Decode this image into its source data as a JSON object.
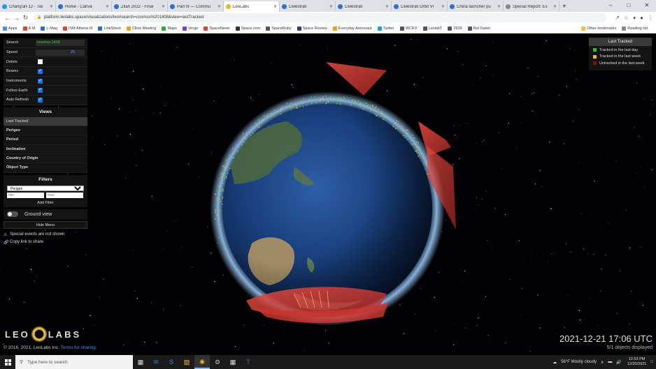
{
  "browser": {
    "tabs": [
      {
        "label": "Chang'an-12 - Twi",
        "color": "#1d9bf0"
      },
      {
        "label": "Home - Canva",
        "color": "#2b6ed6"
      },
      {
        "label": "Zilan 2022 - Final",
        "color": "#2b6ed6"
      },
      {
        "label": "Part III — Commu",
        "color": "#2b6ed6"
      },
      {
        "label": "LeoLabs",
        "color": "#e8b422",
        "active": true
      },
      {
        "label": "Celestrak",
        "color": "#2b6ed6"
      },
      {
        "label": "Celestrak",
        "color": "#2b6ed6"
      },
      {
        "label": "Celestrak Orbit Vi",
        "color": "#2b6ed6"
      },
      {
        "label": "China launcher pu",
        "color": "#2b6ed6"
      },
      {
        "label": "Special Report: Ex",
        "color": "#888888"
      }
    ],
    "new_tab": "+",
    "url": "platform.leolabs.space/visualizations/leo#search=cosmos%201408&view=lastTracked",
    "bookmarks": [
      {
        "label": "Apps",
        "color": "#4a8fe2"
      },
      {
        "label": "A.M",
        "color": "#d43"
      },
      {
        "label": "L-Mag",
        "color": "#2b6ed6"
      },
      {
        "label": "ISM Athena III",
        "color": "#d43"
      },
      {
        "label": "LinkSheet",
        "color": "#2b6ed6"
      },
      {
        "label": "Clinic Meeting",
        "color": "#f0a020"
      },
      {
        "label": "Maps",
        "color": "#3a3"
      },
      {
        "label": "Verge",
        "color": "#7a3fd0"
      },
      {
        "label": "SpaceNews",
        "color": "#d43"
      },
      {
        "label": "Space.com",
        "color": "#333"
      },
      {
        "label": "SpaceRuby",
        "color": "#555"
      },
      {
        "label": "Space Review",
        "color": "#2b3c8c"
      },
      {
        "label": "Everyday Astronaut",
        "color": "#f0a020"
      },
      {
        "label": "Twitter",
        "color": "#1d9bf0"
      },
      {
        "label": "WCRX",
        "color": "#555"
      },
      {
        "label": "LeolabT",
        "color": "#555"
      },
      {
        "label": "2938",
        "color": "#555"
      },
      {
        "label": "Rel Daten",
        "color": "#555"
      }
    ],
    "other_bookmarks": "Other bookmarks",
    "reading_list": "Reading list"
  },
  "controls": {
    "search": {
      "label": "Search",
      "value": "cosmos 1408"
    },
    "speed": {
      "label": "Speed",
      "value": "25",
      "level": 0.0
    },
    "toggles": [
      {
        "label": "Debris",
        "checked": false
      },
      {
        "label": "Beams",
        "checked": true
      },
      {
        "label": "Instruments",
        "checked": true
      },
      {
        "label": "Follow Earth",
        "checked": true
      },
      {
        "label": "Auto Refresh",
        "checked": true
      }
    ]
  },
  "views": {
    "title": "Views",
    "items": [
      "Last Tracked",
      "Perigee",
      "Period",
      "Inclination",
      "Country of Origin",
      "Object Type"
    ],
    "active": 0
  },
  "filters": {
    "title": "Filters",
    "selected": "Perigee",
    "min_placeholder": "min",
    "max_placeholder": "max",
    "add_label": "Add Filter"
  },
  "ground_view": {
    "label": "Ground view",
    "on": false
  },
  "hide_menu": "Hide Menu",
  "special_events": "Special events are not shown",
  "copy_link": "Copy link to share",
  "legend": {
    "title": "Last Tracked",
    "items": [
      {
        "label": "Tracked in the last day",
        "color": "#28c828"
      },
      {
        "label": "Tracked in the last week",
        "color": "#e8c020"
      },
      {
        "label": "Untracked in the last week",
        "color": "#8a1010"
      }
    ]
  },
  "footer": {
    "logo_left": "LEO",
    "logo_right": "LABS",
    "copyright": "© 2016, 2021, LeoLabs Inc.",
    "terms": "Terms for sharing.",
    "datetime": "2021-12-21 17:06 UTC",
    "objects": "5/1 objects displayed"
  },
  "taskbar": {
    "search_placeholder": "Type here to search",
    "weather": "56°F  Mostly cloudy",
    "time": "12:53 PM",
    "date": "12/20/2021"
  }
}
